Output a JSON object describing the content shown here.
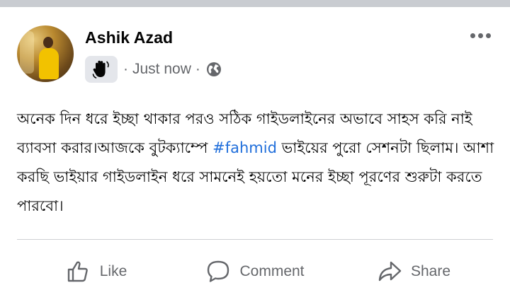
{
  "post": {
    "author": "Ashik Azad",
    "time": "Just now",
    "separator": "·",
    "body_text": "অনেক দিন ধরে ইচ্ছা থাকার পরও সঠিক গাইডলাইনের অভাবে সাহস করি নাই ব্যাবসা করার।আজকে বুটক্যাম্পে ",
    "hashtag": "#fahmid",
    "body_text_after": " ভাইয়ের পুরো সেশনটা ছিলাম। আশা করছি ভাইয়ার গাইডলাইন ধরে সামনেই হয়তো মনের ইচ্ছা পূরণের শুরুটা করতে পারবো।"
  },
  "actions": {
    "like": "Like",
    "comment": "Comment",
    "share": "Share"
  },
  "icons": {
    "badge": "hand-wave-icon",
    "audience": "globe-icon",
    "more": "more-options-icon",
    "like": "thumbs-up-icon",
    "comment": "speech-bubble-icon",
    "share": "share-arrow-icon"
  },
  "colors": {
    "hashtag": "#216fdb",
    "secondary_text": "#65676b",
    "divider": "#ced0d4"
  }
}
